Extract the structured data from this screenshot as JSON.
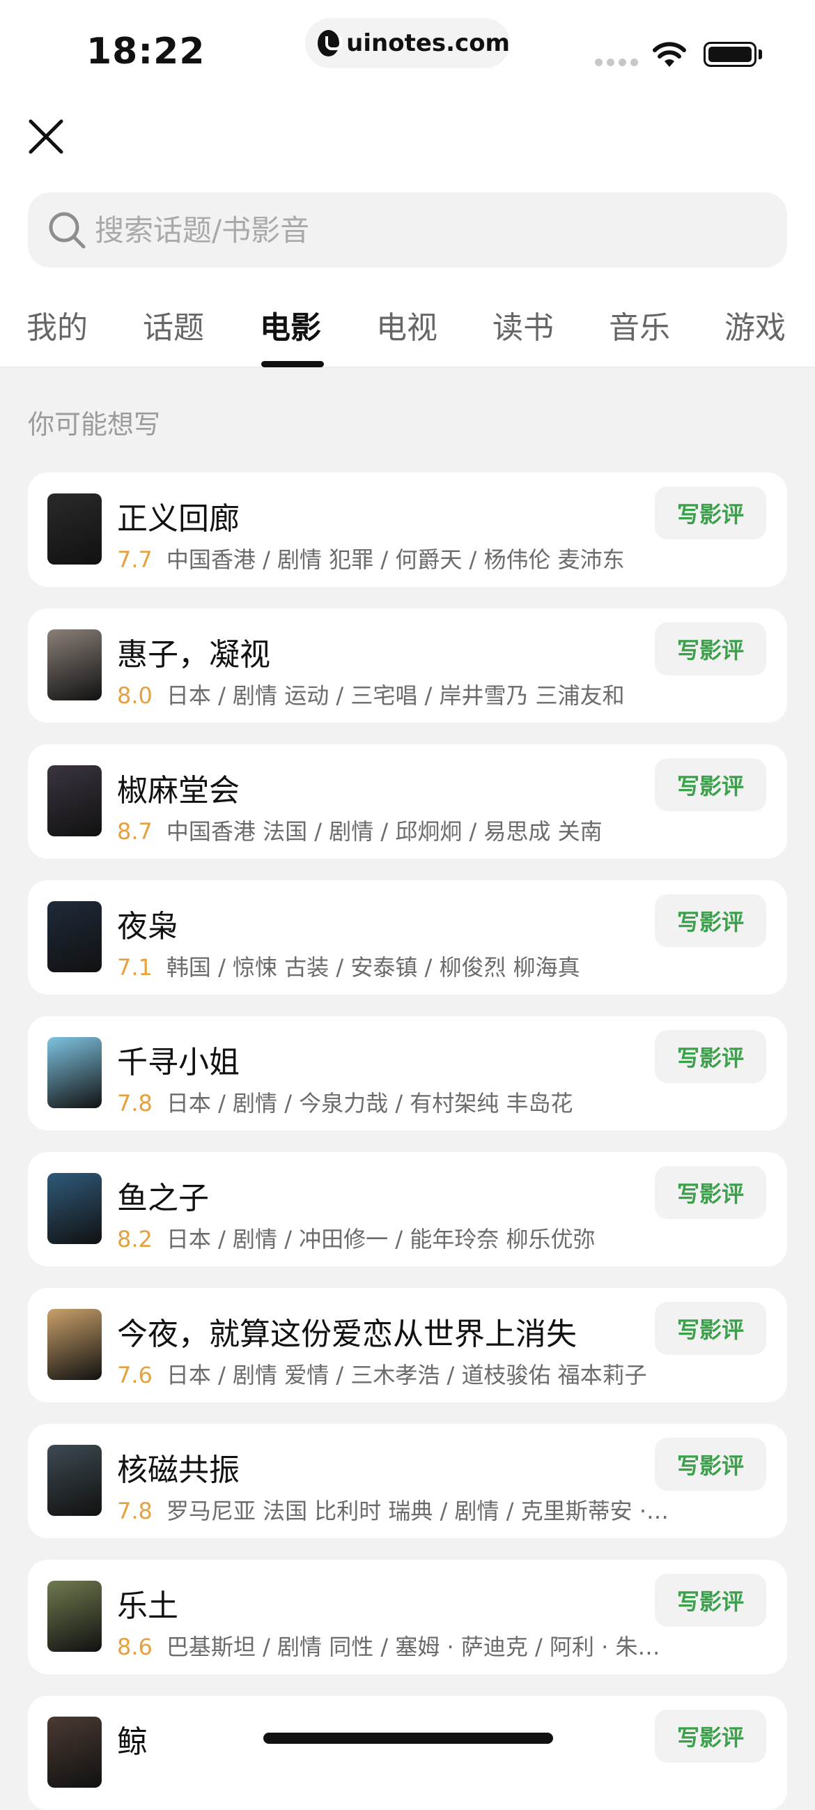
{
  "status_bar": {
    "time": "18:22",
    "url": "uinotes.com"
  },
  "search": {
    "placeholder": "搜索话题/书影音"
  },
  "tabs": [
    {
      "label": "我的"
    },
    {
      "label": "话题"
    },
    {
      "label": "电影",
      "active": true
    },
    {
      "label": "电视"
    },
    {
      "label": "读书"
    },
    {
      "label": "音乐"
    },
    {
      "label": "游戏"
    }
  ],
  "section": {
    "label": "你可能想写"
  },
  "write_label": "写影评",
  "movies": [
    {
      "title": "正义回廊",
      "rating": "7.7",
      "meta": "中国香港 / 剧情 犯罪 / 何爵天 / 杨伟伦 麦沛东",
      "poster_color": "#2a2a2a"
    },
    {
      "title": "惠子，凝视",
      "rating": "8.0",
      "meta": "日本 / 剧情 运动 / 三宅唱 / 岸井雪乃 三浦友和",
      "poster_color": "#8a7f78"
    },
    {
      "title": "椒麻堂会",
      "rating": "8.7",
      "meta": "中国香港 法国 / 剧情 / 邱炯炯 / 易思成 关南",
      "poster_color": "#3b3440"
    },
    {
      "title": "夜枭",
      "rating": "7.1",
      "meta": "韩国 / 惊悚 古装 / 安泰镇 / 柳俊烈 柳海真",
      "poster_color": "#1f2a3a"
    },
    {
      "title": "千寻小姐",
      "rating": "7.8",
      "meta": "日本 / 剧情 / 今泉力哉 / 有村架纯 丰岛花",
      "poster_color": "#7ec3e0"
    },
    {
      "title": "鱼之子",
      "rating": "8.2",
      "meta": "日本 / 剧情 / 冲田修一 / 能年玲奈 柳乐优弥",
      "poster_color": "#2f5a7a"
    },
    {
      "title": "今夜，就算这份爱恋从世界上消失",
      "rating": "7.6",
      "meta": "日本 / 剧情 爱情 / 三木孝浩 / 道枝骏佑 福本莉子",
      "poster_color": "#c9a06a"
    },
    {
      "title": "核磁共振",
      "rating": "7.8",
      "meta": "罗马尼亚 法国 比利时 瑞典 / 剧情 / 克里斯蒂安 · 蒙吉 / 玛...",
      "poster_color": "#3d4a52"
    },
    {
      "title": "乐土",
      "rating": "8.6",
      "meta": "巴基斯坦 / 剧情 同性 / 塞姆 · 萨迪克 / 阿利 · 朱尼乔 拉斯蒂 ...",
      "poster_color": "#6e7a4e"
    },
    {
      "title": "鲸",
      "rating": "",
      "meta": "",
      "poster_color": "#4a3a32"
    }
  ]
}
